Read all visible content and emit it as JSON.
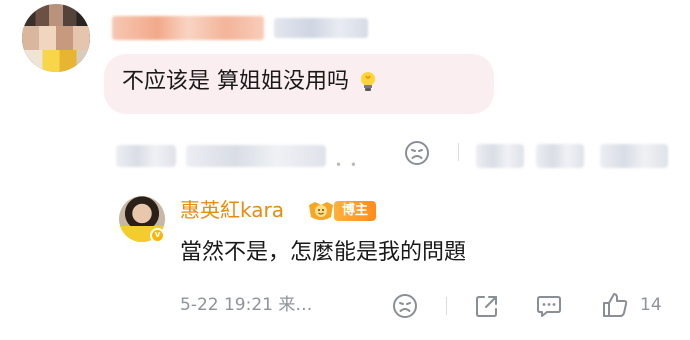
{
  "top_comment": {
    "text": "不应该是 算姐姐没用吗"
  },
  "reply": {
    "username": "惠英紅kara",
    "badge_label": "博主",
    "verified_mark": "v",
    "text": "當然不是，怎麼能是我的問題",
    "meta": "5-22 19:21 来…",
    "like_count": "14"
  },
  "icons": {
    "comment_top_emoji": "sad-face-icon",
    "reply_emoji": "sad-face-icon",
    "share": "share-icon",
    "comment": "comment-icon",
    "like": "thumb-up-icon",
    "bulb": "lightbulb-emoji"
  },
  "colors": {
    "bubble_bg": "#fbeef1",
    "username": "#e88b10",
    "badge": "#ff9a20",
    "meta_text": "#8f939b"
  }
}
